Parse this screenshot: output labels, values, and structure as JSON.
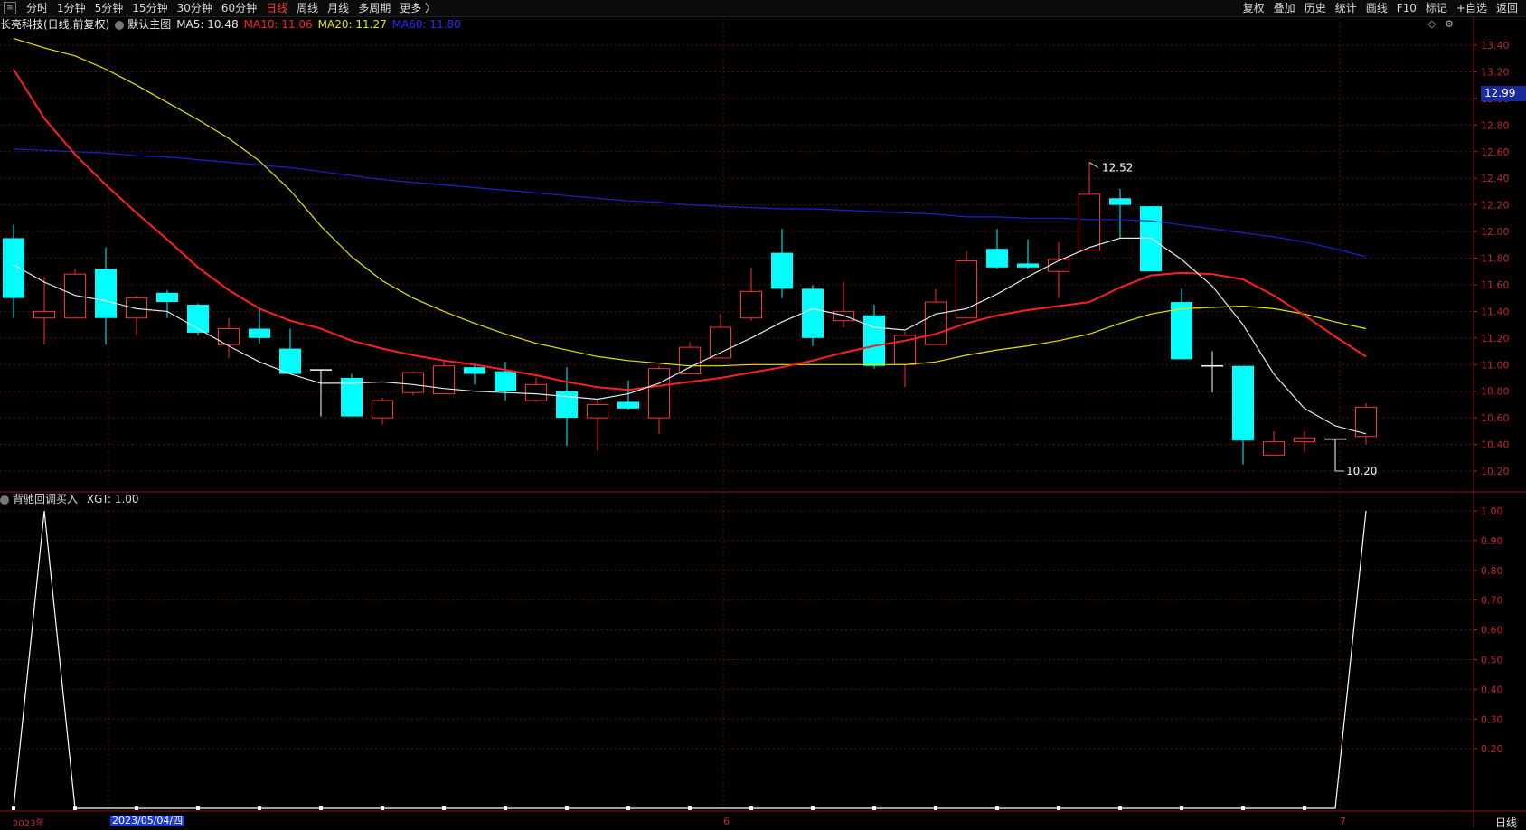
{
  "toolbar": {
    "periods": [
      "分时",
      "1分钟",
      "5分钟",
      "15分钟",
      "30分钟",
      "60分钟",
      "日线",
      "周线",
      "月线",
      "多周期",
      "更多 〉"
    ],
    "active_period": "日线",
    "actions": [
      "复权",
      "叠加",
      "历史",
      "统计",
      "画线",
      "F10",
      "标记",
      "+自选",
      "返回"
    ]
  },
  "main": {
    "title": "长亮科技(日线,前复权)",
    "template": "默认主图",
    "ma5": "MA5: 10.48",
    "ma10": "MA10: 11.06",
    "ma20": "MA20: 11.27",
    "ma60": "MA60: 11.80",
    "colors": {
      "ma5": "#e8e8e8",
      "ma10": "#ff2020",
      "ma20": "#e6e600",
      "ma60": "#2020d0",
      "up": "#ff3030",
      "down": "#00ffff"
    },
    "current_price": "12.99",
    "high_label": "12.52",
    "low_label": "10.20",
    "y_ticks": [
      "13.40",
      "13.20",
      "13.00",
      "12.80",
      "12.60",
      "12.40",
      "12.20",
      "12.00",
      "11.80",
      "11.60",
      "11.40",
      "11.20",
      "11.00",
      "10.80",
      "10.60",
      "10.40",
      "10.20"
    ]
  },
  "sub": {
    "title": "背驰回调买入",
    "xgt": "XGT: 1.00",
    "y_ticks": [
      "1.00",
      "0.90",
      "0.80",
      "0.70",
      "0.60",
      "0.50",
      "0.40",
      "0.30",
      "0.20"
    ]
  },
  "bottom": {
    "year": "2023年",
    "selected_date": "2023/05/04/四",
    "month_6": "6",
    "month_7": "7",
    "period": "日线"
  },
  "chart_data": {
    "type": "candlestick",
    "candles": [
      [
        11.95,
        11.5,
        12.05,
        11.35
      ],
      [
        11.35,
        11.4,
        11.66,
        11.15
      ],
      [
        11.35,
        11.68,
        11.72,
        11.35
      ],
      [
        11.72,
        11.35,
        11.88,
        11.15
      ],
      [
        11.35,
        11.5,
        11.52,
        11.22
      ],
      [
        11.54,
        11.47,
        11.56,
        11.35
      ],
      [
        11.45,
        11.24,
        11.46,
        11.22
      ],
      [
        11.15,
        11.27,
        11.35,
        11.05
      ],
      [
        11.27,
        11.2,
        11.42,
        11.16
      ],
      [
        11.12,
        10.93,
        11.27,
        10.93
      ],
      [
        10.95,
        10.96,
        10.96,
        10.61
      ],
      [
        10.9,
        10.61,
        10.93,
        10.61
      ],
      [
        10.6,
        10.73,
        10.75,
        10.55
      ],
      [
        10.79,
        10.94,
        10.95,
        10.77
      ],
      [
        10.78,
        10.99,
        11.03,
        10.8
      ],
      [
        10.98,
        10.93,
        11.0,
        10.85
      ],
      [
        10.95,
        10.8,
        11.02,
        10.73
      ],
      [
        10.73,
        10.85,
        10.9,
        10.72
      ],
      [
        10.8,
        10.6,
        10.98,
        10.39
      ],
      [
        10.6,
        10.7,
        10.74,
        10.35
      ],
      [
        10.72,
        10.67,
        10.88,
        10.66
      ],
      [
        10.6,
        10.97,
        10.99,
        10.48
      ],
      [
        10.93,
        11.13,
        11.17,
        10.94
      ],
      [
        11.05,
        11.28,
        11.38,
        11.05
      ],
      [
        11.35,
        11.55,
        11.73,
        11.33
      ],
      [
        11.84,
        11.57,
        12.02,
        11.5
      ],
      [
        11.57,
        11.2,
        11.6,
        11.14
      ],
      [
        11.33,
        11.4,
        11.62,
        11.28
      ],
      [
        11.37,
        10.99,
        11.45,
        10.97
      ],
      [
        11.0,
        11.22,
        11.25,
        10.83
      ],
      [
        11.15,
        11.47,
        11.57,
        11.15
      ],
      [
        11.35,
        11.78,
        11.85,
        11.35
      ],
      [
        11.87,
        11.73,
        12.02,
        11.72
      ],
      [
        11.76,
        11.73,
        11.94,
        11.72
      ],
      [
        11.7,
        11.79,
        11.92,
        11.5
      ],
      [
        11.86,
        12.28,
        12.52,
        11.87
      ],
      [
        12.25,
        12.2,
        12.32,
        11.95
      ],
      [
        12.19,
        11.7,
        12.19,
        11.7
      ],
      [
        11.47,
        11.04,
        11.57,
        11.04
      ],
      [
        10.99,
        10.99,
        11.1,
        10.79
      ],
      [
        10.99,
        10.43,
        10.99,
        10.25
      ],
      [
        10.32,
        10.42,
        10.5,
        10.32
      ],
      [
        10.42,
        10.45,
        10.5,
        10.34
      ],
      [
        10.43,
        10.44,
        10.44,
        10.2
      ],
      [
        10.46,
        10.68,
        10.71,
        10.4
      ]
    ],
    "ma5": [
      11.75,
      11.62,
      11.52,
      11.48,
      11.42,
      11.4,
      11.27,
      11.14,
      11.02,
      10.93,
      10.86,
      10.86,
      10.87,
      10.85,
      10.82,
      10.8,
      10.79,
      10.78,
      10.76,
      10.74,
      10.78,
      10.86,
      10.98,
      11.09,
      11.2,
      11.32,
      11.42,
      11.37,
      11.28,
      11.26,
      11.38,
      11.42,
      11.53,
      11.66,
      11.78,
      11.88,
      11.95,
      11.95,
      11.79,
      11.59,
      11.3,
      10.93,
      10.67,
      10.54,
      10.48
    ],
    "ma10": [
      13.22,
      12.85,
      12.58,
      12.35,
      12.14,
      11.94,
      11.73,
      11.56,
      11.42,
      11.33,
      11.27,
      11.18,
      11.12,
      11.07,
      11.03,
      11.0,
      10.96,
      10.92,
      10.87,
      10.83,
      10.81,
      10.84,
      10.87,
      10.9,
      10.94,
      10.98,
      11.03,
      11.09,
      11.14,
      11.18,
      11.23,
      11.31,
      11.37,
      11.41,
      11.44,
      11.47,
      11.58,
      11.67,
      11.69,
      11.68,
      11.64,
      11.52,
      11.37,
      11.21,
      11.06
    ],
    "ma20": [
      13.45,
      13.38,
      13.32,
      13.22,
      13.1,
      12.97,
      12.84,
      12.7,
      12.53,
      12.31,
      12.04,
      11.81,
      11.63,
      11.5,
      11.4,
      11.31,
      11.23,
      11.16,
      11.11,
      11.06,
      11.03,
      11.01,
      10.99,
      10.99,
      11.0,
      11.0,
      11.0,
      11.0,
      11.0,
      11.0,
      11.02,
      11.07,
      11.11,
      11.14,
      11.18,
      11.23,
      11.31,
      11.38,
      11.42,
      11.43,
      11.44,
      11.42,
      11.38,
      11.32,
      11.27
    ],
    "ma60": [
      12.62,
      12.61,
      12.6,
      12.59,
      12.57,
      12.56,
      12.54,
      12.52,
      12.5,
      12.48,
      12.45,
      12.42,
      12.39,
      12.37,
      12.35,
      12.33,
      12.31,
      12.29,
      12.27,
      12.25,
      12.23,
      12.22,
      12.2,
      12.19,
      12.18,
      12.17,
      12.17,
      12.16,
      12.15,
      12.14,
      12.13,
      12.11,
      12.11,
      12.1,
      12.1,
      12.09,
      12.09,
      12.08,
      12.05,
      12.02,
      11.99,
      11.96,
      11.92,
      11.87,
      11.81
    ],
    "xgt": [
      0,
      1,
      0,
      0,
      0,
      0,
      0,
      0,
      0,
      0,
      0,
      0,
      0,
      0,
      0,
      0,
      0,
      0,
      0,
      0,
      0,
      0,
      0,
      0,
      0,
      0,
      0,
      0,
      0,
      0,
      0,
      0,
      0,
      0,
      0,
      0,
      0,
      0,
      0,
      0,
      0,
      0,
      0,
      0,
      1
    ]
  }
}
